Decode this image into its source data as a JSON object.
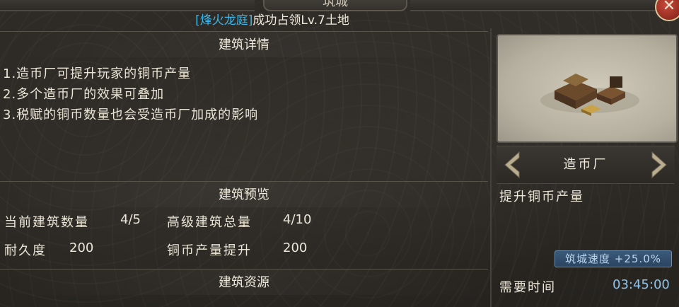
{
  "window": {
    "title": "筑城",
    "close_icon": "close-icon"
  },
  "subtitle": {
    "highlight": "[烽火龙庭]",
    "text": "成功占领Lv.7土地"
  },
  "details": {
    "heading": "建筑详情",
    "lines": [
      "1.造币厂可提升玩家的铜币产量",
      "2.多个造币厂的效果可叠加",
      "3.税赋的铜币数量也会受造币厂加成的影响"
    ]
  },
  "preview": {
    "heading": "建筑预览",
    "current_count_label": "当前建筑数量",
    "current_count_value": "4/5",
    "advanced_total_label": "高级建筑总量",
    "advanced_total_value": "4/10",
    "durability_label": "耐久度",
    "durability_value": "200",
    "copper_boost_label": "铜币产量提升",
    "copper_boost_value": "200"
  },
  "resources": {
    "heading": "建筑资源"
  },
  "building": {
    "name": "造币厂",
    "effect": "提升铜币产量",
    "speed_badge": "筑城速度 +25.0%",
    "time_label": "需要时间",
    "time_value": "03:45:00"
  },
  "colors": {
    "highlight": "#3fb6e8",
    "time": "#8fc3ea",
    "badge": "#2a4460"
  }
}
